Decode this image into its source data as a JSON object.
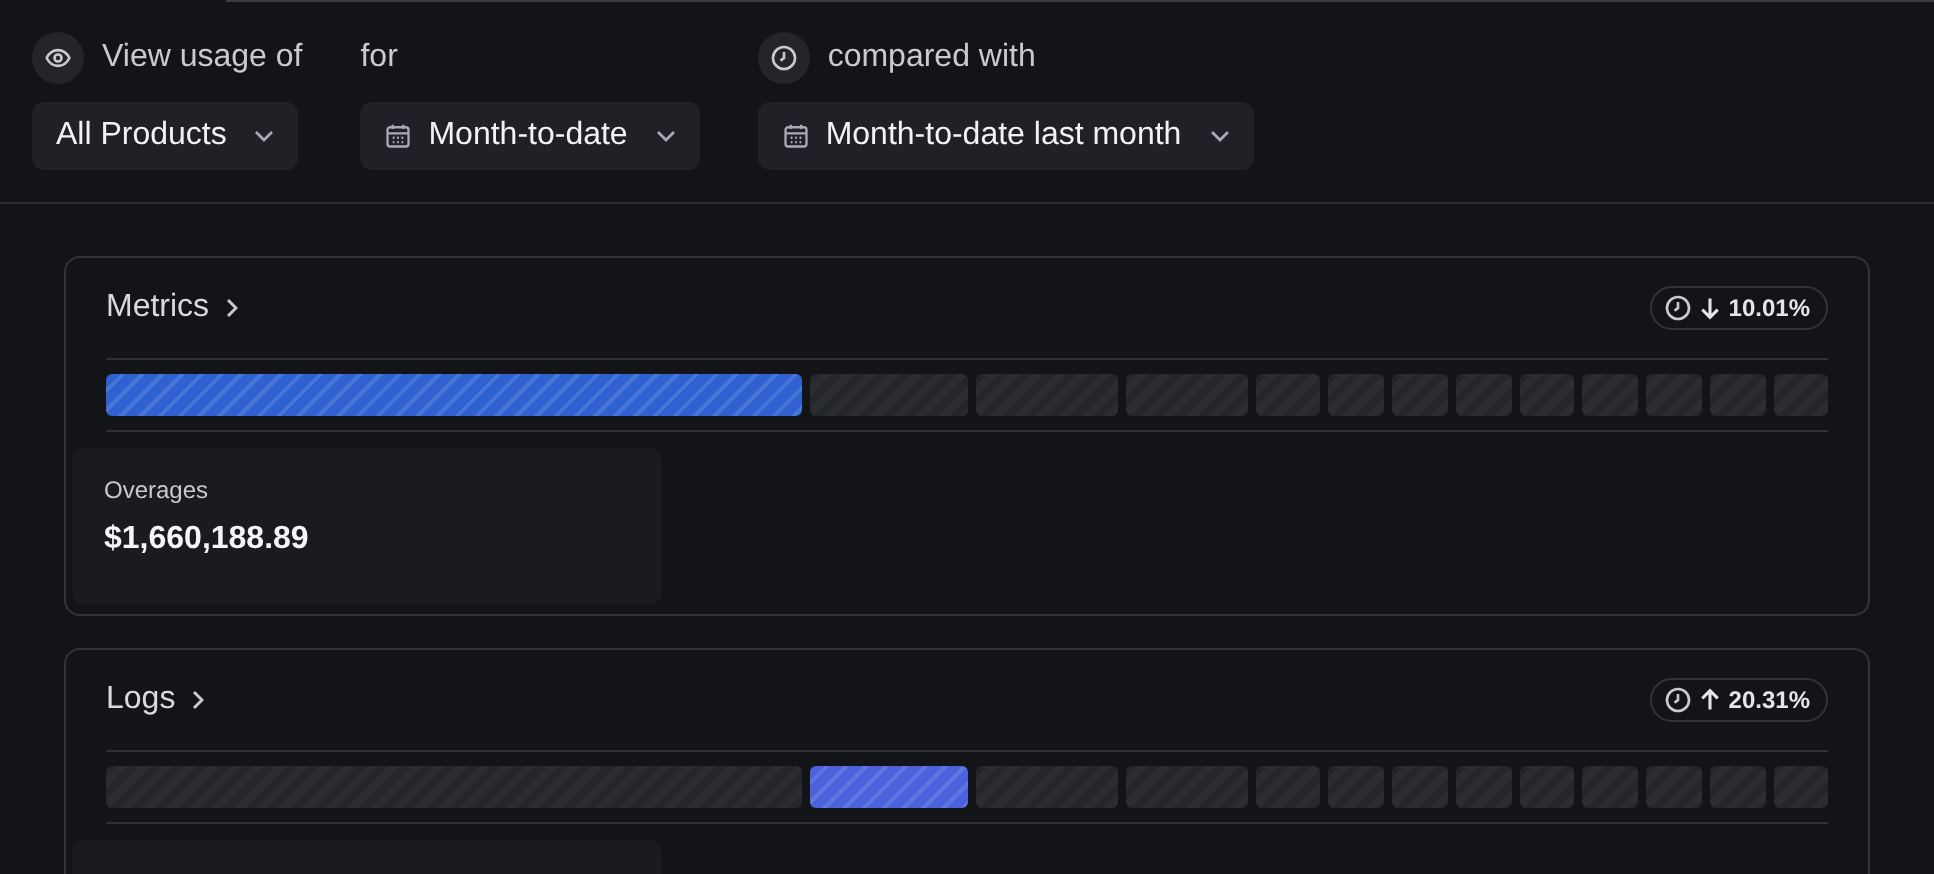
{
  "filters": [
    {
      "kind": "product",
      "label": "View usage of",
      "value": "All Products"
    },
    {
      "kind": "period",
      "label": "for",
      "value": "Month-to-date"
    },
    {
      "kind": "comparison",
      "label": "compared with",
      "value": "Month-to-date last month"
    }
  ],
  "cards": [
    {
      "title": "Metrics",
      "trend": {
        "kind": "decrease",
        "value": "10.01%"
      },
      "color": "#2f62d0",
      "segments": [
        {
          "highlighted": true
        },
        {
          "highlighted": false
        },
        {
          "highlighted": false
        },
        {
          "highlighted": false
        },
        {
          "highlighted": false
        },
        {
          "highlighted": false
        },
        {
          "highlighted": false
        },
        {
          "highlighted": false
        },
        {
          "highlighted": false
        },
        {
          "highlighted": false
        },
        {
          "highlighted": false
        },
        {
          "highlighted": false
        },
        {
          "highlighted": false
        }
      ],
      "stat": {
        "label": "Overages",
        "value": "$1,660,188.89"
      }
    },
    {
      "title": "Logs",
      "trend": {
        "kind": "increase",
        "value": "20.31%"
      },
      "color": "#4b62dd",
      "segments": [
        {
          "highlighted": false
        },
        {
          "highlighted": true
        },
        {
          "highlighted": false
        },
        {
          "highlighted": false
        },
        {
          "highlighted": false
        },
        {
          "highlighted": false
        },
        {
          "highlighted": false
        },
        {
          "highlighted": false
        },
        {
          "highlighted": false
        },
        {
          "highlighted": false
        },
        {
          "highlighted": false
        },
        {
          "highlighted": false
        },
        {
          "highlighted": false
        }
      ]
    }
  ]
}
